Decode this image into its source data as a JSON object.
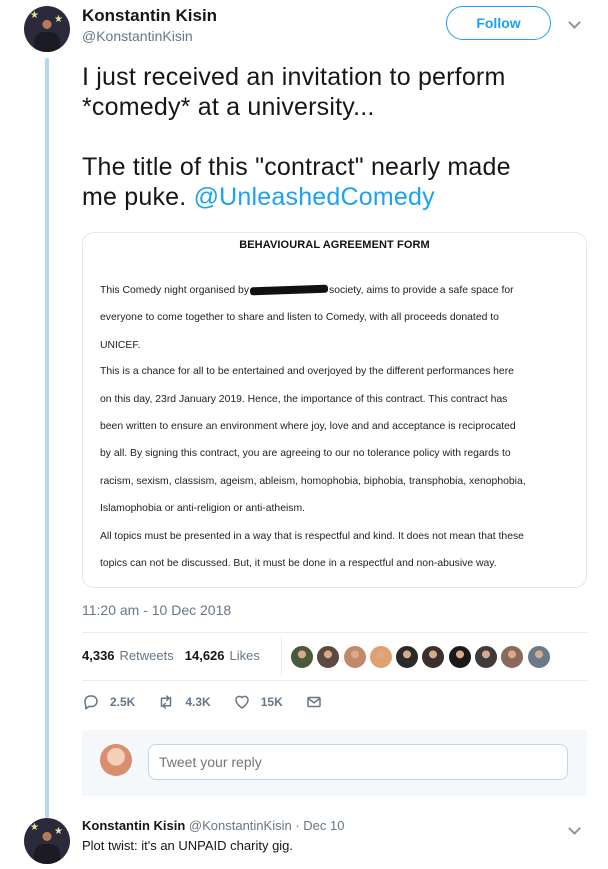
{
  "tweet": {
    "author_name": "Konstantin Kisin",
    "author_handle": "@KonstantinKisin",
    "follow_label": "Follow",
    "text_line1": "I just received an invitation to perform",
    "text_line2": "*comedy* at a university...",
    "text_line3": "The title of this \"contract\" nearly made",
    "text_line4_prefix": "me puke.",
    "mention": "@UnleashedComedy",
    "timestamp": "11:20 am - 10 Dec 2018"
  },
  "document": {
    "title": "BEHAVIOURAL AGREEMENT FORM",
    "line1a": "This Comedy night organised by",
    "line1b": "society, aims to provide a safe space for",
    "line2": "everyone to come together to share and listen to Comedy, with all proceeds donated to",
    "line3": "UNICEF.",
    "line4": "This is a chance for all to be entertained and overjoyed by the different performances here",
    "line5": "on this day, 23rd January 2019. Hence, the importance of this contract. This contract has",
    "line6": "been written to ensure an environment where joy, love and and acceptance is reciprocated",
    "line7": "by all. By signing this contract, you are agreeing to our no tolerance policy with regards to",
    "line8": "racism, sexism, classism, ageism, ableism, homophobia, biphobia, transphobia, xenophobia,",
    "line9": "Islamophobia or anti-religion or anti-atheism.",
    "line10": "All topics must be presented in a way that is respectful and kind. It does not mean that these",
    "line11": "topics can not be discussed. But, it must be done in a respectful and non-abusive way."
  },
  "stats": {
    "retweets_count": "4,336",
    "retweets_label": "Retweets",
    "likes_count": "14,626",
    "likes_label": "Likes",
    "liker_colors": [
      "#4a5a3a",
      "#5a4a40",
      "#c08a6a",
      "#e0a070",
      "#2a2a2a",
      "#3a3030",
      "#1a1a1a",
      "#403a38",
      "#8a6a5a",
      "#6a7a8a"
    ]
  },
  "actions": {
    "reply_count": "2.5K",
    "retweet_count": "4.3K",
    "like_count": "15K",
    "reply_icon": "reply-icon",
    "retweet_icon": "retweet-icon",
    "like_icon": "heart-icon",
    "dm_icon": "envelope-icon"
  },
  "reply_box": {
    "placeholder": "Tweet your reply"
  },
  "reply_tweet": {
    "author_name": "Konstantin Kisin",
    "meta": "@KonstantinKisin · Dec 10",
    "text": "Plot twist: it's an UNPAID charity gig."
  },
  "colors": {
    "accent": "#1da1f2",
    "thread_line": "#b6d8ee",
    "muted": "#657786"
  }
}
